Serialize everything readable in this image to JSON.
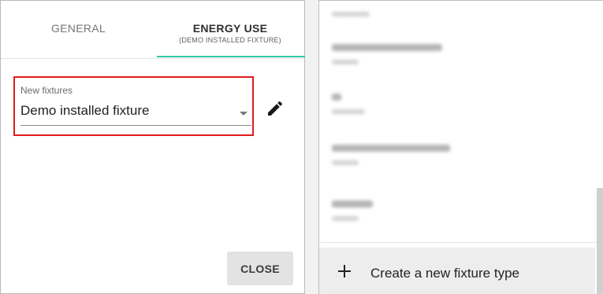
{
  "dialog": {
    "tabs": [
      {
        "label": "GENERAL",
        "sub": ""
      },
      {
        "label": "ENERGY USE",
        "sub": "(DEMO INSTALLED FIXTURE)"
      }
    ],
    "active_tab": "ENERGY USE",
    "accent_color": "#2ec9a3",
    "fixture_select": {
      "label": "New fixtures",
      "value": "Demo installed fixture",
      "highlight_color": "#e11b1b"
    },
    "edit_icon": "pencil-icon",
    "close_label": "CLOSE"
  },
  "dropdown": {
    "create_label": "Create a new fixture type",
    "create_icon": "plus-icon"
  }
}
